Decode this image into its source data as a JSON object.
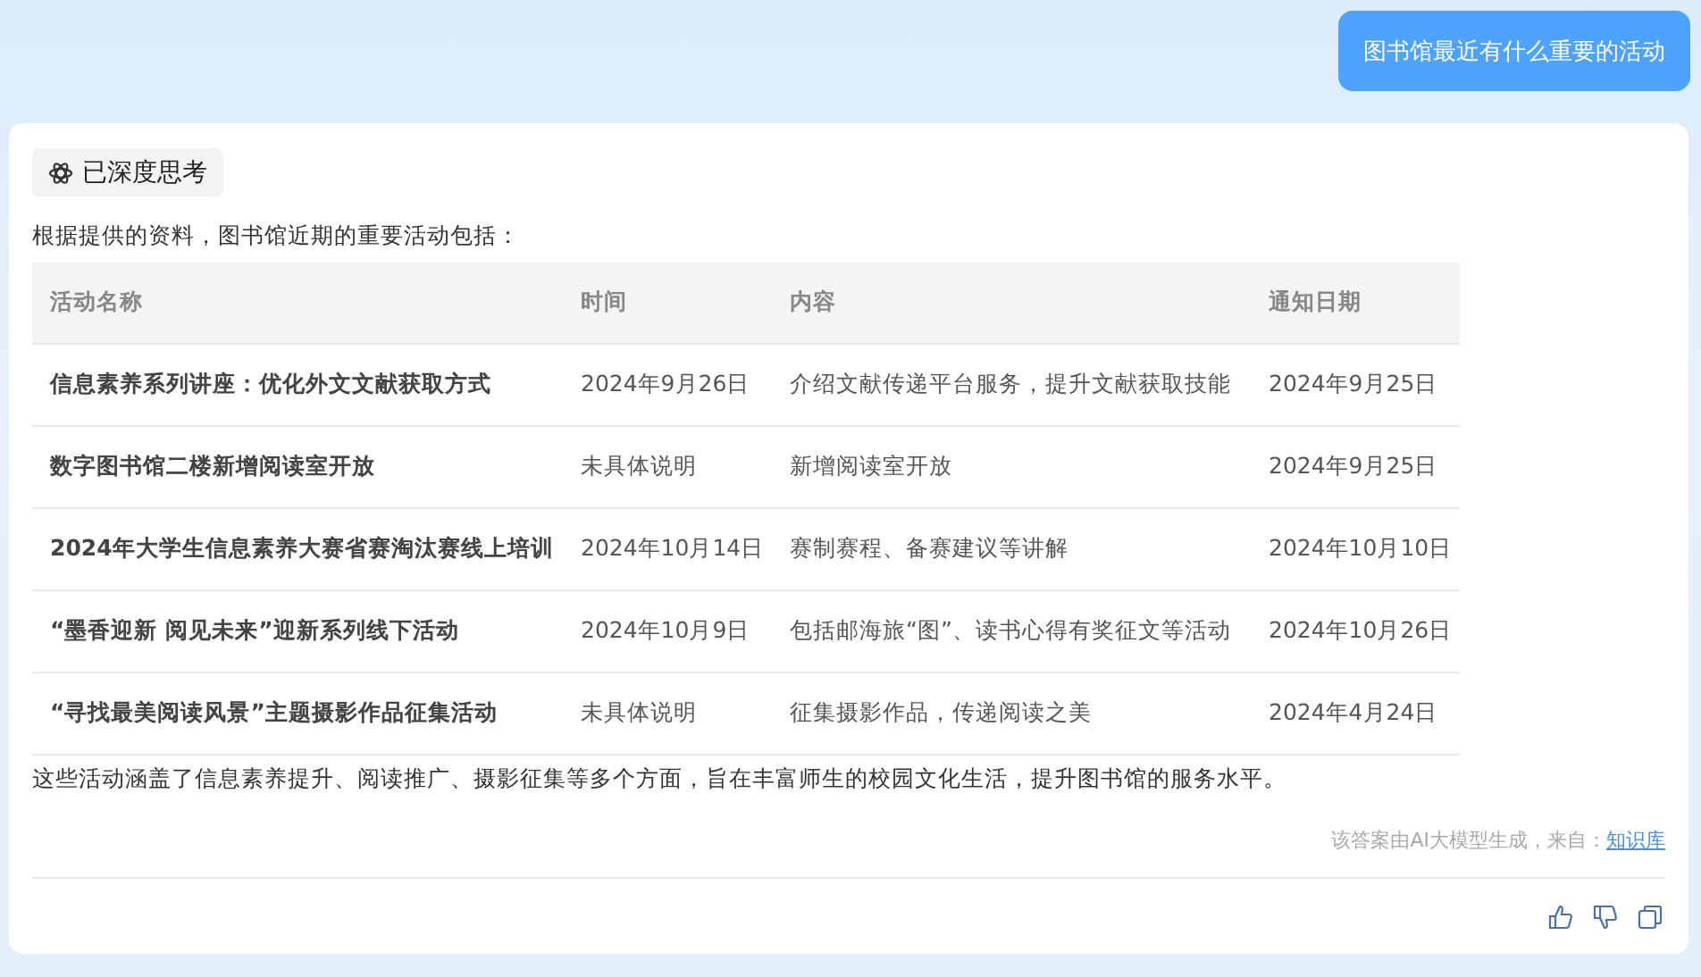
{
  "user_message": "图书馆最近有什么重要的活动",
  "answer": {
    "thinking_chip": "已深度思考",
    "intro": "根据提供的资料，图书馆近期的重要活动包括：",
    "table": {
      "columns": [
        "活动名称",
        "时间",
        "内容",
        "通知日期"
      ],
      "rows": [
        [
          "信息素养系列讲座：优化外文文献获取方式",
          "2024年9月26日",
          "介绍文献传递平台服务，提升文献获取技能",
          "2024年9月25日"
        ],
        [
          "数字图书馆二楼新增阅读室开放",
          "未具体说明",
          "新增阅读室开放",
          "2024年9月25日"
        ],
        [
          "2024年大学生信息素养大赛省赛淘汰赛线上培训",
          "2024年10月14日",
          "赛制赛程、备赛建议等讲解",
          "2024年10月10日"
        ],
        [
          "“墨香迎新 阅见未来”迎新系列线下活动",
          "2024年10月9日",
          "包括邮海旅“图”、读书心得有奖征文等活动",
          "2024年10月26日"
        ],
        [
          "“寻找最美阅读风景”主题摄影作品征集活动",
          "未具体说明",
          "征集摄影作品，传递阅读之美",
          "2024年4月24日"
        ]
      ]
    },
    "summary": "这些活动涵盖了信息素养提升、阅读推广、摄影征集等多个方面，旨在丰富师生的校园文化生活，提升图书馆的服务水平。",
    "source_note": "该答案由AI大模型生成，来自：",
    "source_link": "知识库"
  }
}
